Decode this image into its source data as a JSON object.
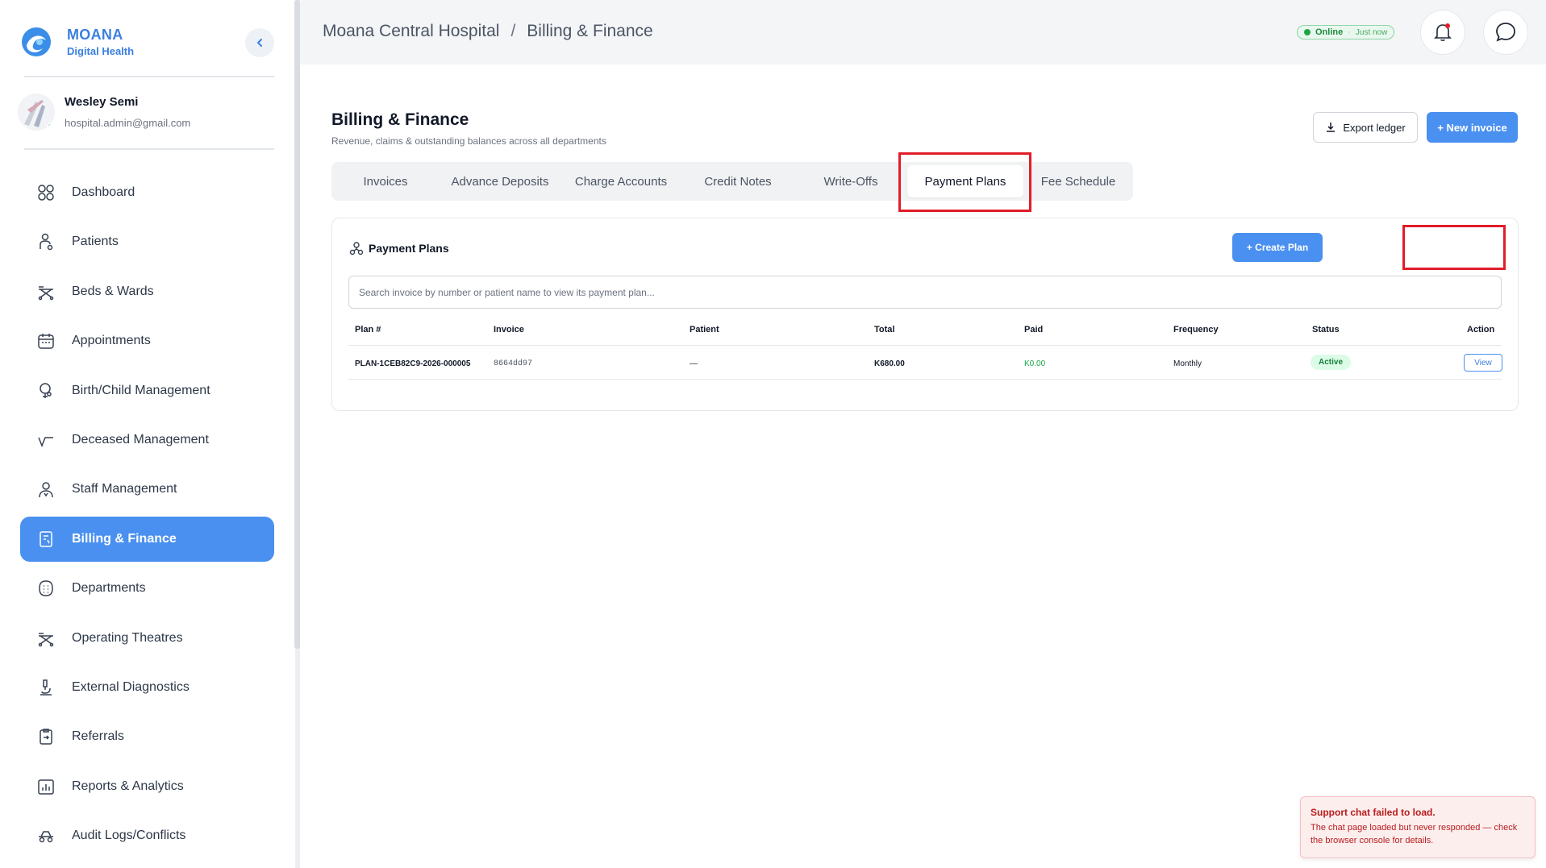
{
  "brand": {
    "name": "MOANA",
    "sub": "Digital Health"
  },
  "user": {
    "name": "Wesley Semi",
    "email": "hospital.admin@gmail.com"
  },
  "sidebar": {
    "items": [
      {
        "label": "Dashboard",
        "icon": "dashboard-icon"
      },
      {
        "label": "Patients",
        "icon": "patients-icon"
      },
      {
        "label": "Beds & Wards",
        "icon": "bed-icon"
      },
      {
        "label": "Appointments",
        "icon": "calendar-icon"
      },
      {
        "label": "Birth/Child Management",
        "icon": "birth-icon"
      },
      {
        "label": "Deceased Management",
        "icon": "deceased-icon"
      },
      {
        "label": "Staff Management",
        "icon": "staff-icon"
      },
      {
        "label": "Billing & Finance",
        "icon": "billing-icon",
        "active": true
      },
      {
        "label": "Departments",
        "icon": "departments-icon"
      },
      {
        "label": "Operating Theatres",
        "icon": "theatre-icon"
      },
      {
        "label": "External Diagnostics",
        "icon": "microscope-icon"
      },
      {
        "label": "Referrals",
        "icon": "referral-icon"
      },
      {
        "label": "Reports & Analytics",
        "icon": "analytics-icon"
      },
      {
        "label": "Audit Logs/Conflicts",
        "icon": "audit-icon"
      }
    ]
  },
  "header": {
    "breadcrumb": [
      "Moana Central Hospital",
      "Billing & Finance"
    ],
    "separator": "/",
    "status": {
      "label": "Online",
      "separator": "·",
      "time": "Just now"
    }
  },
  "page": {
    "title": "Billing & Finance",
    "subtitle": "Revenue, claims & outstanding balances across all departments",
    "export_label": "Export ledger",
    "new_invoice_label": "+ New invoice"
  },
  "tabs": [
    {
      "label": "Invoices"
    },
    {
      "label": "Advance Deposits"
    },
    {
      "label": "Charge Accounts"
    },
    {
      "label": "Credit Notes"
    },
    {
      "label": "Write-Offs"
    },
    {
      "label": "Payment Plans",
      "active": true
    },
    {
      "label": "Fee Schedule"
    }
  ],
  "plans": {
    "title": "Payment Plans",
    "create_label": "+ Create Plan",
    "search_placeholder": "Search invoice by number or patient name to view its payment plan...",
    "columns": [
      "Plan #",
      "Invoice",
      "Patient",
      "Total",
      "Paid",
      "Frequency",
      "Status",
      "Action"
    ],
    "rows": [
      {
        "plan": "PLAN-1CEB82C9-2026-000005",
        "invoice": "8664dd97",
        "patient": "—",
        "total": "K680.00",
        "paid": "K0.00",
        "frequency": "Monthly",
        "status": "Active",
        "action": "View"
      }
    ]
  },
  "toast": {
    "title": "Support chat failed to load.",
    "body": "The chat page loaded but never responded — check the browser console for details."
  },
  "colors": {
    "accent": "#4a90f0",
    "highlight": "#e11d2a",
    "success": "#22a447",
    "error": "#b91c1c"
  }
}
